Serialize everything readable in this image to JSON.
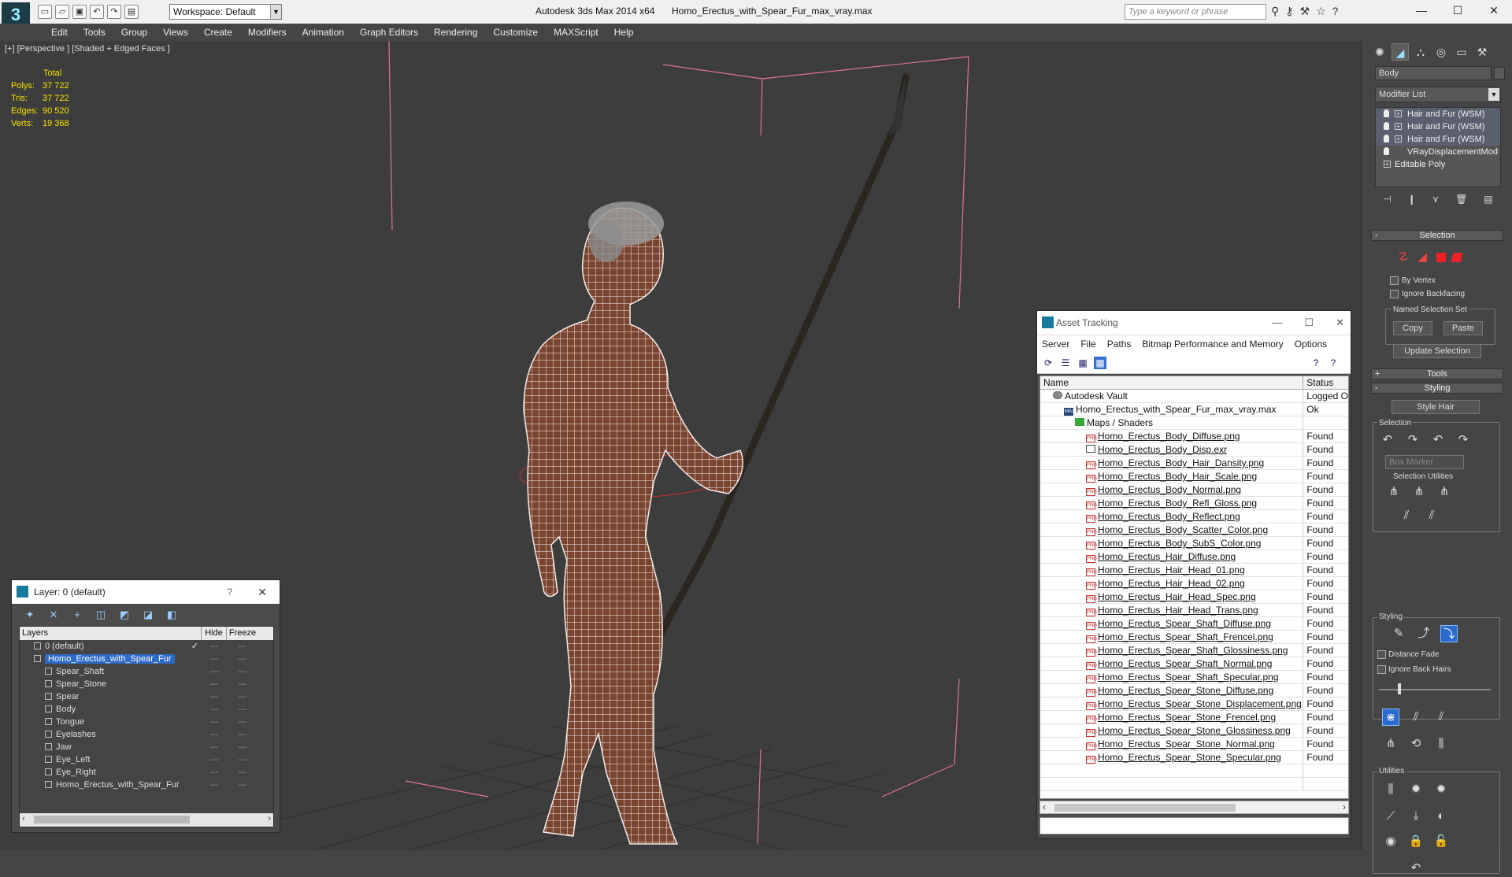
{
  "titlebar": {
    "workspace": "Workspace: Default",
    "app_title": "Autodesk 3ds Max  2014 x64",
    "file_title": "Homo_Erectus_with_Spear_Fur_max_vray.max",
    "search_placeholder": "Type a keyword or phrase"
  },
  "menu": [
    "Edit",
    "Tools",
    "Group",
    "Views",
    "Create",
    "Modifiers",
    "Animation",
    "Graph Editors",
    "Rendering",
    "Customize",
    "MAXScript",
    "Help"
  ],
  "viewport": {
    "label": "[+] [Perspective ] [Shaded + Edged Faces ]",
    "stats_header": "Total",
    "stats": [
      {
        "k": "Polys:",
        "v": "37 722"
      },
      {
        "k": "Tris:",
        "v": "37 722"
      },
      {
        "k": "Edges:",
        "v": "90 520"
      },
      {
        "k": "Verts:",
        "v": "19 368"
      }
    ]
  },
  "layer_window": {
    "title": "Layer: 0 (default)",
    "help": "?",
    "columns": {
      "layers": "Layers",
      "hide": "Hide",
      "freeze": "Freeze"
    },
    "rows": [
      {
        "name": "0 (default)",
        "indent": 1,
        "check": "✓",
        "selected": false,
        "type": "layer"
      },
      {
        "name": "Homo_Erectus_with_Spear_Fur",
        "indent": 1,
        "check": "",
        "selected": true,
        "type": "layer"
      },
      {
        "name": "Spear_Shaft",
        "indent": 2,
        "check": "",
        "selected": false,
        "type": "obj"
      },
      {
        "name": "Spear_Stone",
        "indent": 2,
        "check": "",
        "selected": false,
        "type": "obj"
      },
      {
        "name": "Spear",
        "indent": 2,
        "check": "",
        "selected": false,
        "type": "obj"
      },
      {
        "name": "Body",
        "indent": 2,
        "check": "",
        "selected": false,
        "type": "obj"
      },
      {
        "name": "Tongue",
        "indent": 2,
        "check": "",
        "selected": false,
        "type": "obj"
      },
      {
        "name": "Eyelashes",
        "indent": 2,
        "check": "",
        "selected": false,
        "type": "obj"
      },
      {
        "name": "Jaw",
        "indent": 2,
        "check": "",
        "selected": false,
        "type": "obj"
      },
      {
        "name": "Eye_Left",
        "indent": 2,
        "check": "",
        "selected": false,
        "type": "obj"
      },
      {
        "name": "Eye_Right",
        "indent": 2,
        "check": "",
        "selected": false,
        "type": "obj"
      },
      {
        "name": "Homo_Erectus_with_Spear_Fur",
        "indent": 2,
        "check": "",
        "selected": false,
        "type": "obj"
      }
    ]
  },
  "asset_tracking": {
    "title": "Asset Tracking",
    "menu": [
      "Server",
      "File",
      "Paths",
      "Bitmap Performance and Memory",
      "Options"
    ],
    "columns": {
      "name": "Name",
      "status": "Status"
    },
    "rows": [
      {
        "name": "Autodesk Vault",
        "status": "Logged O",
        "indent": 0,
        "tag": "vault",
        "tag_text": ""
      },
      {
        "name": "Homo_Erectus_with_Spear_Fur_max_vray.max",
        "status": "Ok",
        "indent": 1,
        "tag": "max",
        "tag_text": "MAX"
      },
      {
        "name": "Maps / Shaders",
        "status": "",
        "indent": 2,
        "tag": "green",
        "tag_text": ""
      },
      {
        "name": "Homo_Erectus_Body_Diffuse.png",
        "status": "Found",
        "indent": 3,
        "tag": "png",
        "tag_text": "PNG"
      },
      {
        "name": "Homo_Erectus_Body_Disp.exr",
        "status": "Found",
        "indent": 3,
        "tag": "exr",
        "tag_text": ""
      },
      {
        "name": "Homo_Erectus_Body_Hair_Dansity.png",
        "status": "Found",
        "indent": 3,
        "tag": "png",
        "tag_text": "PNG"
      },
      {
        "name": "Homo_Erectus_Body_Hair_Scale.png",
        "status": "Found",
        "indent": 3,
        "tag": "png",
        "tag_text": "PNG"
      },
      {
        "name": "Homo_Erectus_Body_Normal.png",
        "status": "Found",
        "indent": 3,
        "tag": "png",
        "tag_text": "PNG"
      },
      {
        "name": "Homo_Erectus_Body_Refl_Gloss.png",
        "status": "Found",
        "indent": 3,
        "tag": "png",
        "tag_text": "PNG"
      },
      {
        "name": "Homo_Erectus_Body_Reflect.png",
        "status": "Found",
        "indent": 3,
        "tag": "png",
        "tag_text": "PNG"
      },
      {
        "name": "Homo_Erectus_Body_Scatter_Color.png",
        "status": "Found",
        "indent": 3,
        "tag": "png",
        "tag_text": "PNG"
      },
      {
        "name": "Homo_Erectus_Body_SubS_Color.png",
        "status": "Found",
        "indent": 3,
        "tag": "png",
        "tag_text": "PNG"
      },
      {
        "name": "Homo_Erectus_Hair_Diffuse.png",
        "status": "Found",
        "indent": 3,
        "tag": "png",
        "tag_text": "PNG"
      },
      {
        "name": "Homo_Erectus_Hair_Head_01.png",
        "status": "Found",
        "indent": 3,
        "tag": "png",
        "tag_text": "PNG"
      },
      {
        "name": "Homo_Erectus_Hair_Head_02.png",
        "status": "Found",
        "indent": 3,
        "tag": "png",
        "tag_text": "PNG"
      },
      {
        "name": "Homo_Erectus_Hair_Head_Spec.png",
        "status": "Found",
        "indent": 3,
        "tag": "png",
        "tag_text": "PNG"
      },
      {
        "name": "Homo_Erectus_Hair_Head_Trans.png",
        "status": "Found",
        "indent": 3,
        "tag": "png",
        "tag_text": "PNG"
      },
      {
        "name": "Homo_Erectus_Spear_Shaft_Diffuse.png",
        "status": "Found",
        "indent": 3,
        "tag": "png",
        "tag_text": "PNG"
      },
      {
        "name": "Homo_Erectus_Spear_Shaft_Frencel.png",
        "status": "Found",
        "indent": 3,
        "tag": "png",
        "tag_text": "PNG"
      },
      {
        "name": "Homo_Erectus_Spear_Shaft_Glossiness.png",
        "status": "Found",
        "indent": 3,
        "tag": "png",
        "tag_text": "PNG"
      },
      {
        "name": "Homo_Erectus_Spear_Shaft_Normal.png",
        "status": "Found",
        "indent": 3,
        "tag": "png",
        "tag_text": "PNG"
      },
      {
        "name": "Homo_Erectus_Spear_Shaft_Specular.png",
        "status": "Found",
        "indent": 3,
        "tag": "png",
        "tag_text": "PNG"
      },
      {
        "name": "Homo_Erectus_Spear_Stone_Diffuse.png",
        "status": "Found",
        "indent": 3,
        "tag": "png",
        "tag_text": "PNG"
      },
      {
        "name": "Homo_Erectus_Spear_Stone_Displacement.png",
        "status": "Found",
        "indent": 3,
        "tag": "png",
        "tag_text": "PNG"
      },
      {
        "name": "Homo_Erectus_Spear_Stone_Frencel.png",
        "status": "Found",
        "indent": 3,
        "tag": "png",
        "tag_text": "PNG"
      },
      {
        "name": "Homo_Erectus_Spear_Stone_Glossiness.png",
        "status": "Found",
        "indent": 3,
        "tag": "png",
        "tag_text": "PNG"
      },
      {
        "name": "Homo_Erectus_Spear_Stone_Normal.png",
        "status": "Found",
        "indent": 3,
        "tag": "png",
        "tag_text": "PNG"
      },
      {
        "name": "Homo_Erectus_Spear_Stone_Specular.png",
        "status": "Found",
        "indent": 3,
        "tag": "png",
        "tag_text": "PNG"
      }
    ]
  },
  "command_panel": {
    "object_name": "Body",
    "modifier_list": "Modifier List",
    "stack": [
      {
        "label": "Hair and Fur (WSM)",
        "kind": "hair"
      },
      {
        "label": "Hair and Fur (WSM)",
        "kind": "hair"
      },
      {
        "label": "Hair and Fur (WSM)",
        "kind": "hair"
      },
      {
        "label": "VRayDisplacementMod",
        "kind": "mod"
      },
      {
        "label": "Editable Poly",
        "kind": "poly"
      }
    ],
    "selection_title": "Selection",
    "by_vertex": "By Vertex",
    "ignore_backfacing": "Ignore Backfacing",
    "named_sel_set": "Named Selection Set",
    "copy": "Copy",
    "paste": "Paste",
    "update_selection": "Update Selection",
    "tools_title": "Tools",
    "styling_title": "Styling",
    "style_hair": "Style Hair",
    "sub_selection": "Selection",
    "box_marker": "Box Marker",
    "selection_utilities": "Selection Utilities",
    "sub_styling": "Styling",
    "distance_fade": "Distance Fade",
    "ignore_back_hairs": "Ignore Back Hairs",
    "utilities": "Utilities",
    "plus": "+",
    "minus": "-"
  },
  "colors": {
    "viewport_bg": "#3d3d3d",
    "stats_text": "#f7e300",
    "wire": "#ffffff",
    "skin": "#7a4530",
    "bbox": "#e070a0",
    "selection_blue": "#2d6bc9"
  }
}
